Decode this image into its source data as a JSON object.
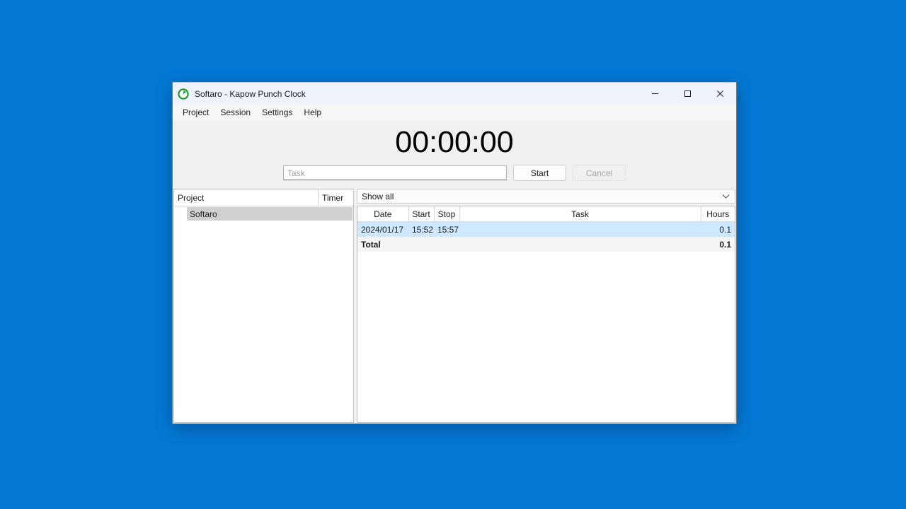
{
  "desktop": {
    "background_color": "#0378d4"
  },
  "window": {
    "title": "Softaro - Kapow Punch Clock",
    "icon": "green-clock-icon",
    "controls": {
      "minimize": "minimize-button",
      "maximize": "maximize-button",
      "close": "close-button"
    }
  },
  "menubar": {
    "items": [
      {
        "label": "Project"
      },
      {
        "label": "Session"
      },
      {
        "label": "Settings"
      },
      {
        "label": "Help"
      }
    ]
  },
  "timer": {
    "display": "00:00:00",
    "task_placeholder": "Task",
    "task_value": "",
    "start_label": "Start",
    "cancel_label": "Cancel",
    "cancel_disabled": true
  },
  "projects": {
    "headers": {
      "project": "Project",
      "timer": "Timer"
    },
    "rows": [
      {
        "name": "Softaro",
        "timer": "",
        "selected": true
      }
    ]
  },
  "sessions": {
    "filter": {
      "selected": "Show all",
      "icon": "chevron-down-icon"
    },
    "headers": {
      "date": "Date",
      "start": "Start",
      "stop": "Stop",
      "task": "Task",
      "hours": "Hours"
    },
    "rows": [
      {
        "date": "2024/01/17",
        "start": "15:52",
        "stop": "15:57",
        "task": "",
        "hours": "0.1",
        "selected": true
      }
    ],
    "total": {
      "label": "Total",
      "hours": "0.1"
    }
  },
  "colors": {
    "titlebar": "#eef2fb",
    "selection_blue": "#cde8ff",
    "selection_gray": "#d0d0d0",
    "accent_icon_green": "#1f9c2f"
  }
}
